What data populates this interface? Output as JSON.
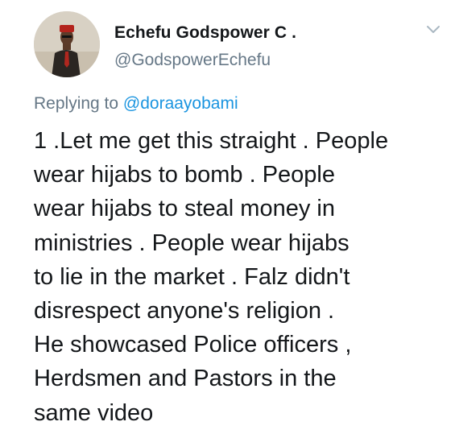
{
  "author": {
    "name": "Echefu Godspower C .",
    "handle": "@GodspowerEchefu"
  },
  "reply": {
    "prefix": "Replying to ",
    "mention": "@doraayobami"
  },
  "tweet_lines": [
    "1 .Let me get this straight . People",
    "wear hijabs to bomb . People",
    "wear hijabs to steal money in",
    "ministries . People wear hijabs",
    "to lie in the market . Falz didn't",
    "disrespect anyone's religion .",
    "He showcased Police officers ,",
    "Herdsmen and Pastors in the",
    "same video"
  ],
  "icons": {
    "avatar": "profile-photo",
    "menu": "chevron-down-icon"
  },
  "colors": {
    "text": "#14171a",
    "secondary": "#657786",
    "link": "#1b95e0"
  }
}
